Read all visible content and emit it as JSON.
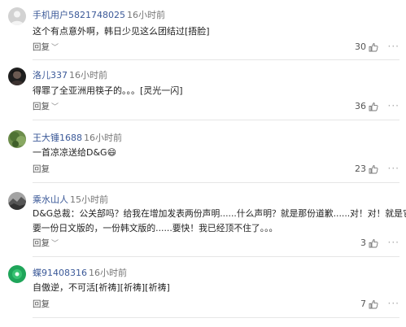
{
  "comments": [
    {
      "username": "手机用户5821748025",
      "time": "16小时前",
      "lines": [
        "这个有点意外啊，韩日少见这么团结过[捂脸]"
      ],
      "reply_label": "回复",
      "likes": "30",
      "avatar_icon": "gray-silhouette",
      "avatar_color": "#c9c9c9"
    },
    {
      "username": "洛儿337",
      "time": "16小时前",
      "lines": [
        "得罪了全亚洲用筷子的。。。[灵光一闪]"
      ],
      "reply_label": "回复",
      "likes": "36",
      "avatar_icon": "dark-photo",
      "avatar_color": "#2b2b2b"
    },
    {
      "username": "王大锤1688",
      "time": "16小时前",
      "lines": [
        "一首凉凉送给D&G😄"
      ],
      "reply_label": "回复",
      "likes": "23",
      "avatar_icon": "green-photo",
      "avatar_color": "#5a7f3e"
    },
    {
      "username": "乘水山人",
      "time": "15小时前",
      "lines": [
        "D&G总裁：公关部吗？给我在增加发表两份声明......什么声明？就是那份道歉......对！对！就是它！",
        "要一份日文版的，一份韩文版的......要快！我已经顶不住了。。。"
      ],
      "reply_label": "回复",
      "likes": "3",
      "avatar_icon": "gray-photo",
      "avatar_color": "#9a9a9a"
    },
    {
      "username": "蝶91408316",
      "time": "16小时前",
      "lines": [
        "自傲逆，不可活[祈祷][祈祷][祈祷]"
      ],
      "reply_label": "回复",
      "likes": "7",
      "avatar_icon": "green-circle",
      "avatar_color": "#1fa55a"
    }
  ],
  "icons": {
    "like": "thumbs-up-icon",
    "more": "more-dots-icon",
    "reply_chevron": "chevron-down-icon"
  },
  "more_glyph": "···",
  "chevron_glyph": "﹀"
}
